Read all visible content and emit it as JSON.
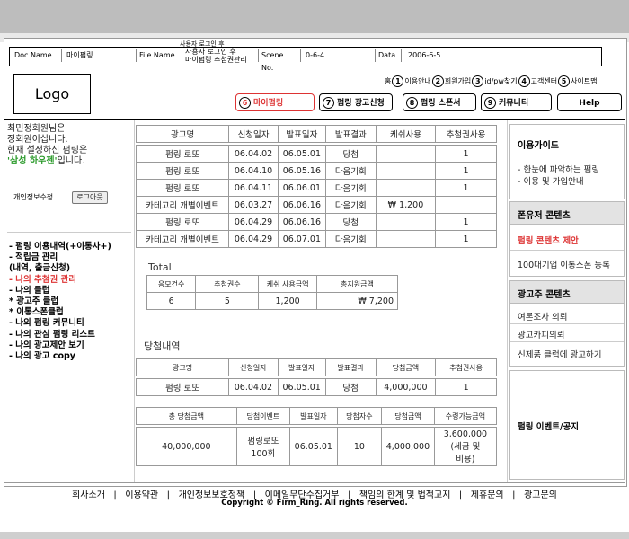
{
  "docinfo": {
    "doc_name_label": "Doc Name",
    "doc_name": "마이펌링",
    "file_name_label": "File  Name",
    "file_name_line1": "사용자 로그인 후",
    "file_name_line2": "마이펌링 추첨권관리",
    "file_name_top": "사용자 로그인 후",
    "scene_label": "Scene No.",
    "scene_value": "0-6-4",
    "data_label": "Data",
    "data_value": "2006-6-5"
  },
  "logo": "Logo",
  "utilnav": {
    "home": "홈",
    "items": [
      {
        "num": "1",
        "label": "이용안내"
      },
      {
        "num": "2",
        "label": "회원가입"
      },
      {
        "num": "3",
        "label": "id/pw찾기"
      },
      {
        "num": "4",
        "label": "고객센터"
      },
      {
        "num": "5",
        "label": "사이트맵"
      }
    ]
  },
  "mainnav": [
    {
      "num": "6",
      "label": "마이펌링"
    },
    {
      "num": "7",
      "label": "펌링 광고신청"
    },
    {
      "num": "8",
      "label": "펌링 스폰서"
    },
    {
      "num": "9",
      "label": "커뮤니티"
    },
    {
      "num": "",
      "label": "Help"
    }
  ],
  "left": {
    "welcome_1": "최민정회원님은",
    "welcome_2": "정회원이십니다.",
    "welcome_3": "현재 설정하신 펌링은",
    "welcome_4_green": "'삼성 하우젠'",
    "welcome_4_rest": "입니다.",
    "profile_edit": "개인정보수정",
    "logout": "로그아웃",
    "menu": [
      "- 펌링 이용내역(+이통사+)",
      "- 적립금 관리",
      "  (내역, 출금신청)",
      "- 나의 추첨권 관리",
      "- 나의 클럽",
      "  * 광고주 클럽",
      "  * 이통스폰클럽",
      "- 나의 펌링 커뮤니티",
      "- 나의 관심 펌링 리스트",
      "- 나의 광고제안 보기",
      "- 나의 광고 copy"
    ]
  },
  "table1": {
    "headers": [
      "광고명",
      "신청일자",
      "발표일자",
      "발표결과",
      "케쉬사용",
      "추첨권사용"
    ],
    "rows": [
      [
        "펌링 로또",
        "06.04.02",
        "06.05.01",
        "당첨",
        "",
        "1"
      ],
      [
        "펌링 로또",
        "06.04.10",
        "06.05.16",
        "다음기회",
        "",
        "1"
      ],
      [
        "펌링 로또",
        "06.04.11",
        "06.06.01",
        "다음기회",
        "",
        "1"
      ],
      [
        "카테고리 개별이벤트",
        "06.03.27",
        "06.06.16",
        "다음기회",
        "₩  1,200",
        ""
      ],
      [
        "펌링 로또",
        "06.04.29",
        "06.06.16",
        "당첨",
        "",
        "1"
      ],
      [
        "카테고리 개별이벤트",
        "06.04.29",
        "06.07.01",
        "다음기회",
        "",
        "1"
      ]
    ]
  },
  "total": {
    "title": "Total",
    "headers": [
      "응모건수",
      "추첨권수",
      "케쉬 사용금액",
      "총지원금액"
    ],
    "values": [
      "6",
      "5",
      "1,200",
      "₩ 7,200"
    ]
  },
  "win": {
    "title": "당첨내역",
    "headers": [
      "광고명",
      "신청일자",
      "발표일자",
      "발표결과",
      "당첨금액",
      "추첨권사용"
    ],
    "row": [
      "펌링 로또",
      "06.04.02",
      "06.05.01",
      "당첨",
      "4,000,000",
      "1"
    ]
  },
  "prize": {
    "headers": [
      "총 당첨금액",
      "당첨이벤트",
      "발표일자",
      "당첨자수",
      "당첨금액",
      "수령가능금액"
    ],
    "row": [
      "40,000,000",
      "펌링로또\n100회",
      "06.05.01",
      "10",
      "4,000,000",
      "3,600,000\n(세금 및\n비용)"
    ],
    "event_1": "펌링로또",
    "event_2": "100회",
    "recv_1": "3,600,000",
    "recv_2": "(세금 및",
    "recv_3": "비용)"
  },
  "right": {
    "guide_title": "이용가이드",
    "guide_1": "- 한눈에 파악하는 펌링",
    "guide_2": "- 이용 및 가입안내",
    "phone_title": "폰유저 콘텐츠",
    "phone_1": "펌링 콘텐츠 제안",
    "phone_2": "100대기업 이통스폰 등록",
    "adv_title": "광고주 콘텐츠",
    "adv_1": "여론조사 의뢰",
    "adv_2": "광고카피의뢰",
    "adv_3": "신제품 클럽에 광고하기",
    "event": "펌링 이벤트/공지"
  },
  "footer": {
    "links": "회사소개   |   이용약관   |   개인정보보호정책   |   이메일무단수집거부   |   책임의 한계 및 법적고지   |   제휴문의   |   광고문의",
    "copyright": "Copyright © Firm_Ring.  All rights reserved."
  },
  "colors": {
    "accent_red": "#dd3333",
    "green": "#2a9a2a",
    "panel_gray": "#e3e3e3"
  }
}
